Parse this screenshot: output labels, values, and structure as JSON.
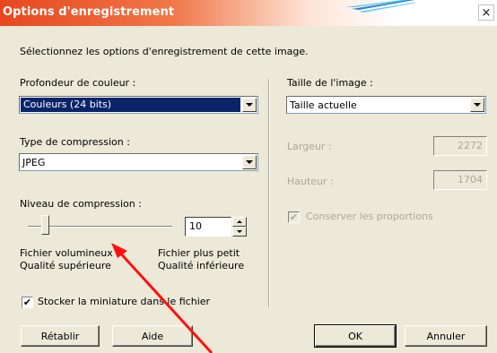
{
  "title": "Options d'enregistrement",
  "close_glyph": "×",
  "intro": "Sélectionnez les options d'enregistrement de cette image.",
  "color_depth": {
    "label": "Profondeur de couleur :",
    "value": "Couleurs (24 bits)"
  },
  "compression_type": {
    "label": "Type de compression :",
    "value": "JPEG"
  },
  "compression_level": {
    "label": "Niveau de compression :",
    "value": "10",
    "slider_level": 0.12,
    "left_text_1": "Fichier volumineux",
    "left_text_2": "Qualité supérieure",
    "right_text_1": "Fichier plus petit",
    "right_text_2": "Qualité inférieure"
  },
  "thumbnail": {
    "label": "Stocker la miniature dans le fichier",
    "checked": true,
    "mark": "✔"
  },
  "image_size": {
    "label": "Taille de l'image :",
    "value": "Taille actuelle",
    "width_label": "Largeur :",
    "width_value": "2272",
    "height_label": "Hauteur :",
    "height_value": "1704",
    "keep_ratio_label": "Conserver les proportions",
    "keep_ratio_mark": "✔"
  },
  "buttons": {
    "reset": "Rétablir",
    "help": "Aide",
    "ok": "OK",
    "cancel": "Annuler"
  },
  "colors": {
    "accent": "#e8471e",
    "annotation": "#ff1010",
    "selection": "#0a246a"
  }
}
